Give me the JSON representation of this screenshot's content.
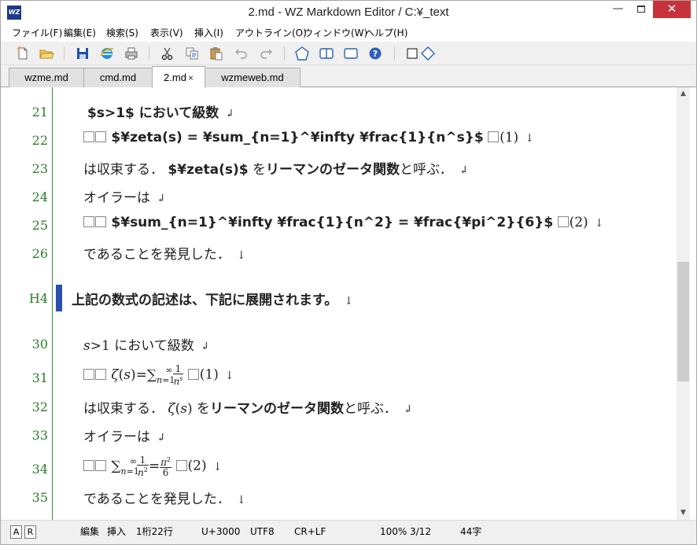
{
  "window": {
    "title": "2.md - WZ Markdown Editor / C:¥_text",
    "app_icon_label": "WZ"
  },
  "menu": [
    "ファイル(F)",
    "編集(E)",
    "検索(S)",
    "表示(V)",
    "挿入(I)",
    "アウトライン(O)",
    "ウィンドウ(W)",
    "ヘルプ(H)"
  ],
  "tabs": [
    {
      "label": "wzme.md",
      "active": false
    },
    {
      "label": "cmd.md",
      "active": false
    },
    {
      "label": "2.md",
      "active": true,
      "close": "×"
    },
    {
      "label": "wzmeweb.md",
      "active": false
    }
  ],
  "editor": {
    "lines": [
      {
        "no": "21",
        "text": "$s>1$ において級数"
      },
      {
        "no": "22",
        "text": "$¥zeta(s) = ¥sum_{n=1}^¥infty ¥frac{1}{n^s}$",
        "tail": "(1)"
      },
      {
        "no": "23",
        "pre": "は収束する．",
        "bold1": "$¥zeta(s)$",
        "mid": " を",
        "bold2": "リーマンのゼータ関数",
        "post": "と呼ぶ．"
      },
      {
        "no": "24",
        "text": "オイラーは"
      },
      {
        "no": "25",
        "text": "$¥sum_{n=1}^¥infty ¥frac{1}{n^2} = ¥frac{¥pi^2}{6}$",
        "tail": "(2)"
      },
      {
        "no": "26",
        "text": "であることを発見した．"
      },
      {
        "no": "H4",
        "text": "上記の数式の記述は、下記に展開されます。"
      },
      {
        "no": "30",
        "text": "において級数"
      },
      {
        "no": "31",
        "tail": "(1)"
      },
      {
        "no": "32",
        "pre": "は収束する．",
        "mid": " を",
        "bold2": "リーマンのゼータ関数",
        "post": "と呼ぶ．"
      },
      {
        "no": "33",
        "text": "オイラーは"
      },
      {
        "no": "34",
        "tail": "(2)"
      },
      {
        "no": "35",
        "text": "であることを発見した．"
      }
    ],
    "return_glyph": "↲",
    "newline_glyph": "↓"
  },
  "status": {
    "box_a": "A",
    "box_r": "R",
    "mode": "編集",
    "insert": "挿入",
    "position": "1桁22行",
    "codepoint": "U+3000",
    "encoding": "UTF8",
    "line_ending": "CR+LF",
    "zoom": "100%",
    "page": "3/12",
    "chars": "44字"
  }
}
